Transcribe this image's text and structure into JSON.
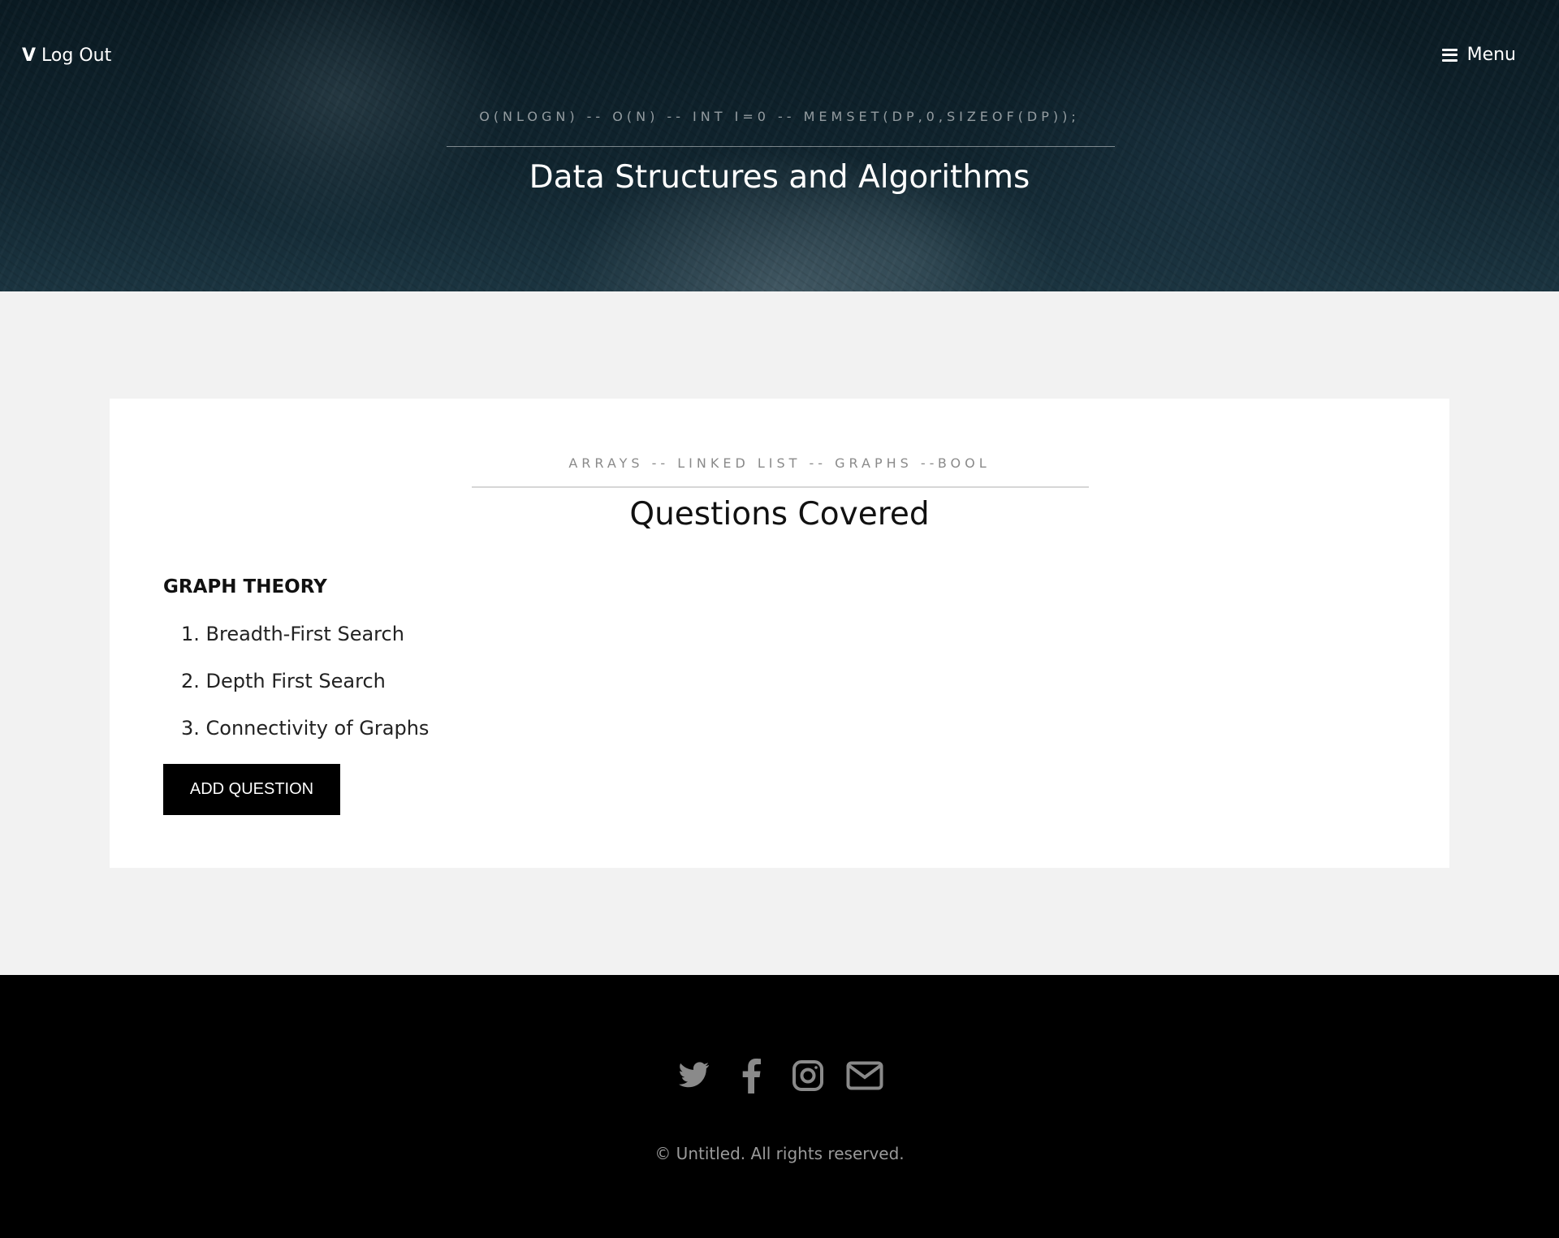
{
  "header": {
    "logout_initial": "V",
    "logout_label": "Log Out",
    "menu_label": "Menu",
    "menu_icon": "hamburger-icon",
    "hero_subtitle": "O(NLOGN) -- O(N) -- INT I=0 -- MEMSET(DP,0,SIZEOF(DP));",
    "hero_title": "Data Structures and Algorithms"
  },
  "main": {
    "subtitle": "ARRAYS -- LINKED LIST -- GRAPHS --BOOL",
    "title": "Questions Covered",
    "section_title": "GRAPH THEORY",
    "questions": [
      "1. Breadth-First Search",
      "2. Depth First Search",
      "3. Connectivity of Graphs"
    ],
    "add_button_label": "ADD QUESTION"
  },
  "footer": {
    "social_icons": [
      "twitter-icon",
      "facebook-icon",
      "instagram-icon",
      "email-icon"
    ],
    "copyright": "© Untitled. All rights reserved."
  },
  "colors": {
    "header_bg": "#10242e",
    "page_bg": "#f2f2f2",
    "card_bg": "#ffffff",
    "button_bg": "#000000",
    "footer_bg": "#000000",
    "icon_gray": "#8a8a8a"
  }
}
